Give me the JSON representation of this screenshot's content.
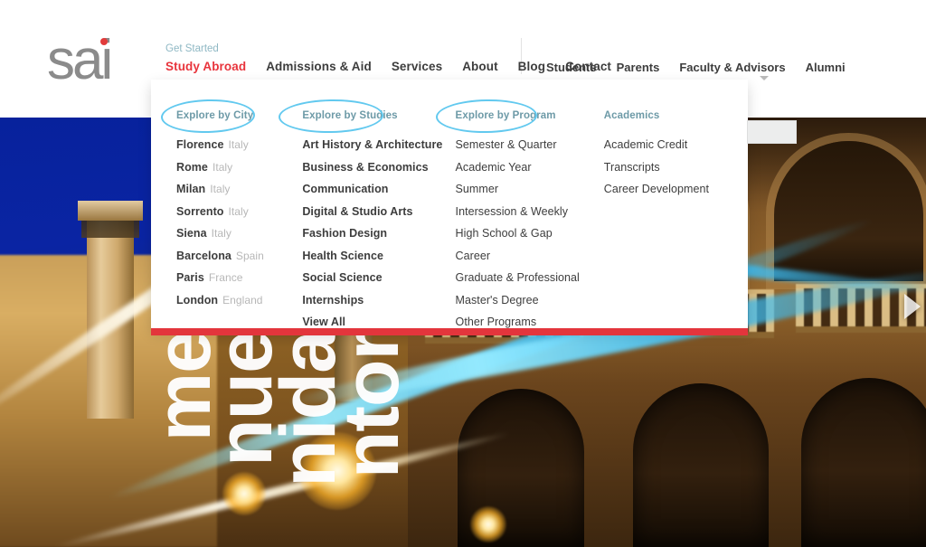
{
  "brand": {
    "logo_text": "sai",
    "dot_color": "#e23b3b"
  },
  "header": {
    "utility_link": "Get Started",
    "divider": "",
    "main_nav": [
      {
        "label": "Study Abroad",
        "active": true
      },
      {
        "label": "Admissions & Aid",
        "active": false
      },
      {
        "label": "Services",
        "active": false
      },
      {
        "label": "About",
        "active": false
      },
      {
        "label": "Blog",
        "active": false
      },
      {
        "label": "Contact",
        "active": false
      }
    ],
    "audience_nav": [
      {
        "label": "Students"
      },
      {
        "label": "Parents"
      },
      {
        "label": "Faculty & Advisors"
      },
      {
        "label": "Alumni"
      }
    ],
    "caret_icon": "chevron-down-icon",
    "search_box_value": ""
  },
  "mega_menu": {
    "accent_color": "#e3353c",
    "annotation_color": "#62c9ef",
    "columns": [
      {
        "heading": "Explore by City",
        "annotated": true,
        "items": [
          {
            "name": "Florence",
            "country": "Italy"
          },
          {
            "name": "Rome",
            "country": "Italy"
          },
          {
            "name": "Milan",
            "country": "Italy"
          },
          {
            "name": "Sorrento",
            "country": "Italy"
          },
          {
            "name": "Siena",
            "country": "Italy"
          },
          {
            "name": "Barcelona",
            "country": "Spain"
          },
          {
            "name": "Paris",
            "country": "France"
          },
          {
            "name": "London",
            "country": "England"
          }
        ]
      },
      {
        "heading": "Explore by Studies",
        "annotated": true,
        "items": [
          {
            "name": "Art History & Architecture",
            "country": ""
          },
          {
            "name": "Business & Economics",
            "country": ""
          },
          {
            "name": "Communication",
            "country": ""
          },
          {
            "name": "Digital & Studio Arts",
            "country": ""
          },
          {
            "name": "Fashion Design",
            "country": ""
          },
          {
            "name": "Health Science",
            "country": ""
          },
          {
            "name": "Social Science",
            "country": ""
          },
          {
            "name": "Internships",
            "country": ""
          },
          {
            "name": "View All",
            "country": ""
          }
        ]
      },
      {
        "heading": "Explore by Program",
        "annotated": true,
        "items": [
          {
            "name": "Semester & Quarter",
            "country": ""
          },
          {
            "name": "Academic Year",
            "country": ""
          },
          {
            "name": "Summer",
            "country": ""
          },
          {
            "name": "Intersession & Weekly",
            "country": ""
          },
          {
            "name": "High School & Gap",
            "country": ""
          },
          {
            "name": "Career",
            "country": ""
          },
          {
            "name": "Graduate & Professional",
            "country": ""
          },
          {
            "name": "Master's Degree",
            "country": ""
          },
          {
            "name": "Other Programs",
            "country": ""
          }
        ]
      },
      {
        "heading": "Academics",
        "annotated": false,
        "items": [
          {
            "name": "Academic Credit",
            "country": ""
          },
          {
            "name": "Transcripts",
            "country": ""
          },
          {
            "name": "Career Development",
            "country": ""
          }
        ]
      }
    ]
  },
  "hero": {
    "words": [
      "me",
      "nue",
      "nida",
      "ntor"
    ],
    "next_icon": "next-slide-arrow-icon"
  }
}
